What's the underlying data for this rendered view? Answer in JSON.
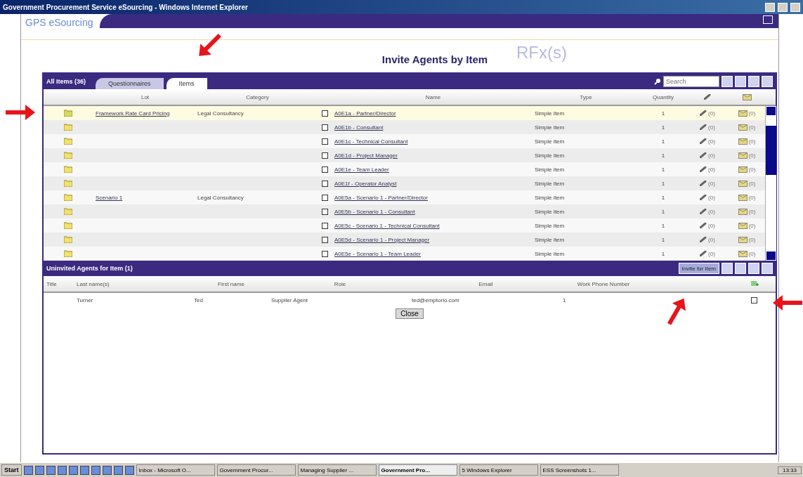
{
  "window": {
    "title": "Government Procurement Service eSourcing - Windows Internet Explorer"
  },
  "app": {
    "logo": "GPS eSourcing",
    "watermark": "RFx(s)",
    "page_title": "Invite Agents by Item"
  },
  "items_panel": {
    "title": "All Items (36)",
    "tabs": [
      {
        "label": "Questionnaires",
        "selected": false
      },
      {
        "label": "Items",
        "selected": true
      }
    ],
    "search": {
      "placeholder": "Search"
    },
    "columns": [
      "Lot",
      "Category",
      "Name",
      "Type",
      "Quantity"
    ],
    "rows": [
      {
        "lot": "Framework Rate Card Pricing",
        "category": "Legal Consultancy",
        "checked": false,
        "name": "A0E1a - Partner/Director",
        "type": "Simple Item",
        "quantity": "1",
        "attachments": "(0)",
        "messages": "(0)",
        "selected": true
      },
      {
        "lot": "",
        "category": "",
        "checked": false,
        "name": "A0E1b - Consultant",
        "type": "Simple Item",
        "quantity": "1",
        "attachments": "(0)",
        "messages": "(0)",
        "selected": false
      },
      {
        "lot": "",
        "category": "",
        "checked": false,
        "name": "A0E1c - Technical Consultant",
        "type": "Simple Item",
        "quantity": "1",
        "attachments": "(0)",
        "messages": "(0)",
        "selected": false
      },
      {
        "lot": "",
        "category": "",
        "checked": false,
        "name": "A0E1d - Project Manager",
        "type": "Simple Item",
        "quantity": "1",
        "attachments": "(0)",
        "messages": "(0)",
        "selected": false
      },
      {
        "lot": "",
        "category": "",
        "checked": false,
        "name": "A0E1e - Team Leader",
        "type": "Simple Item",
        "quantity": "1",
        "attachments": "(0)",
        "messages": "(0)",
        "selected": false
      },
      {
        "lot": "",
        "category": "",
        "checked": false,
        "name": "A0E1f - Operator Analyst",
        "type": "Simple Item",
        "quantity": "1",
        "attachments": "(0)",
        "messages": "(0)",
        "selected": false
      },
      {
        "lot": "Scenario 1",
        "category": "Legal Consultancy",
        "checked": false,
        "name": "A0E5a - Scenario 1 - Partner/Director",
        "type": "Simple Item",
        "quantity": "1",
        "attachments": "(0)",
        "messages": "(0)",
        "selected": false
      },
      {
        "lot": "",
        "category": "",
        "checked": false,
        "name": "A0E5b - Scenario 1 - Consultant",
        "type": "Simple Item",
        "quantity": "1",
        "attachments": "(0)",
        "messages": "(0)",
        "selected": false
      },
      {
        "lot": "",
        "category": "",
        "checked": false,
        "name": "A0E5c - Scenario 1 - Technical Consultant",
        "type": "Simple Item",
        "quantity": "1",
        "attachments": "(0)",
        "messages": "(0)",
        "selected": false
      },
      {
        "lot": "",
        "category": "",
        "checked": false,
        "name": "A0E5d - Scenario 1 - Project Manager",
        "type": "Simple Item",
        "quantity": "1",
        "attachments": "(0)",
        "messages": "(0)",
        "selected": false
      },
      {
        "lot": "",
        "category": "",
        "checked": false,
        "name": "A0E5e - Scenario 1 - Team Leader",
        "type": "Simple Item",
        "quantity": "1",
        "attachments": "(0)",
        "messages": "(0)",
        "selected": false
      }
    ]
  },
  "agents_panel": {
    "title": "Uninvited Agents for Item (1)",
    "invite_button": "Invite for Item",
    "columns": [
      "Title",
      "Last name(s)",
      "First name",
      "Role",
      "Email",
      "Work Phone Number"
    ],
    "rows": [
      {
        "title": "",
        "last_name": "Turner",
        "first_name": "Ted",
        "role": "Supplier Agent",
        "email": "ted@emptorio.com",
        "column_6": "1",
        "phone": "",
        "checked": false
      }
    ],
    "close_button": "Close"
  },
  "taskbar": {
    "start": "Start",
    "tasks": [
      {
        "label": "Inbox - Microsoft O...",
        "selected": false
      },
      {
        "label": "Government Procur...",
        "selected": false
      },
      {
        "label": "Managing Supplier ...",
        "selected": false
      },
      {
        "label": "Government Pro...",
        "selected": true
      },
      {
        "label": "5 Windows Explorer",
        "selected": false
      },
      {
        "label": "ESS Screenshots 1...",
        "selected": false
      }
    ],
    "clock": "13:33"
  }
}
